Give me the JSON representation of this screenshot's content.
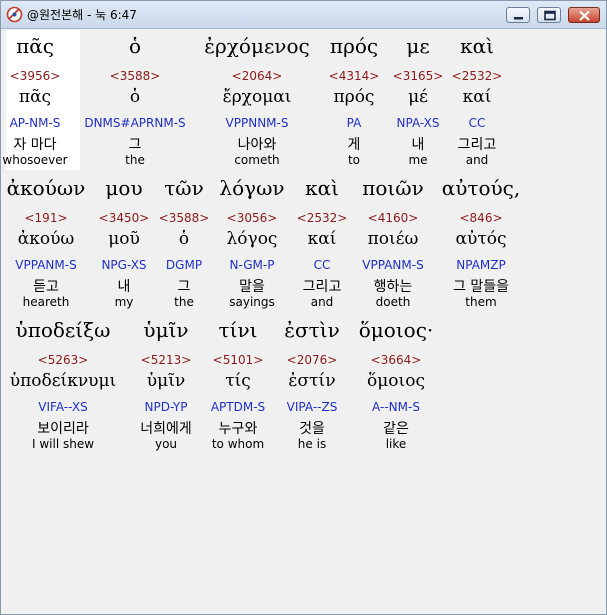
{
  "window": {
    "title": "@원전본해 - 눅 6:47",
    "controls": [
      "minimize",
      "maximize",
      "close"
    ]
  },
  "rows": [
    {
      "words": [
        {
          "greek": "πᾶς",
          "strong": "<3956>",
          "lemma": "πᾶς",
          "parsing": "AP-NM-S",
          "korean": "자 마다",
          "english": "whosoever"
        },
        {
          "greek": "ὁ",
          "strong": "<3588>",
          "lemma": "ὁ",
          "parsing": "DNMS#APRNM-S",
          "korean": "그",
          "english": "the"
        },
        {
          "greek": "ἐρχόμενος",
          "strong": "<2064>",
          "lemma": "ἔρχομαι",
          "parsing": "VPPNNM-S",
          "korean": "나아와",
          "english": "cometh"
        },
        {
          "greek": "πρός",
          "strong": "<4314>",
          "lemma": "πρός",
          "parsing": "PA",
          "korean": "게",
          "english": "to"
        },
        {
          "greek": "με",
          "strong": "<3165>",
          "lemma": "μέ",
          "parsing": "NPA-XS",
          "korean": "내",
          "english": "me"
        },
        {
          "greek": "καὶ",
          "strong": "<2532>",
          "lemma": "καί",
          "parsing": "CC",
          "korean": "그리고",
          "english": "and"
        }
      ]
    },
    {
      "words": [
        {
          "greek": "ἀκούων",
          "strong": "<191>",
          "lemma": "ἀκούω",
          "parsing": "VPPANM-S",
          "korean": "듣고",
          "english": "heareth"
        },
        {
          "greek": "μου",
          "strong": "<3450>",
          "lemma": "μοῦ",
          "parsing": "NPG-XS",
          "korean": "내",
          "english": "my"
        },
        {
          "greek": "τῶν",
          "strong": "<3588>",
          "lemma": "ὁ",
          "parsing": "DGMP",
          "korean": "그",
          "english": "the"
        },
        {
          "greek": "λόγων",
          "strong": "<3056>",
          "lemma": "λόγος",
          "parsing": "N-GM-P",
          "korean": "말을",
          "english": "sayings"
        },
        {
          "greek": "καὶ",
          "strong": "<2532>",
          "lemma": "καί",
          "parsing": "CC",
          "korean": "그리고",
          "english": "and"
        },
        {
          "greek": "ποιῶν",
          "strong": "<4160>",
          "lemma": "ποιέω",
          "parsing": "VPPANM-S",
          "korean": "행하는",
          "english": "doeth"
        },
        {
          "greek": "αὐτούς,",
          "strong": "<846>",
          "lemma": "αὐτός",
          "parsing": "NPAMZP",
          "korean": "그 말들을",
          "english": "them"
        }
      ]
    },
    {
      "words": [
        {
          "greek": "ὑποδείξω",
          "strong": "<5263>",
          "lemma": "ὑποδείκνυμι",
          "parsing": "VIFA--XS",
          "korean": "보이리라",
          "english": "I will shew"
        },
        {
          "greek": "ὑμῖν",
          "strong": "<5213>",
          "lemma": "ὑμῖν",
          "parsing": "NPD-YP",
          "korean": "너희에게",
          "english": "you"
        },
        {
          "greek": "τίνι",
          "strong": "<5101>",
          "lemma": "τίς",
          "parsing": "APTDM-S",
          "korean": "누구와",
          "english": "to whom"
        },
        {
          "greek": "ἐστὶν",
          "strong": "<2076>",
          "lemma": "ἐστίν",
          "parsing": "VIPA--ZS",
          "korean": "것을",
          "english": "he is"
        },
        {
          "greek": "ὅμοιος·",
          "strong": "<3664>",
          "lemma": "ὅμοιος",
          "parsing": "A--NM-S",
          "korean": "같은",
          "english": "like"
        }
      ]
    }
  ]
}
